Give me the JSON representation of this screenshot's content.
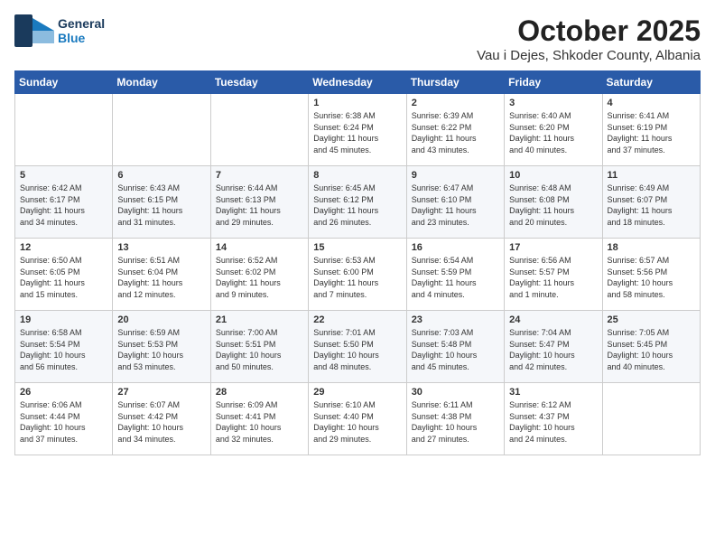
{
  "header": {
    "logo": {
      "general": "General",
      "blue": "Blue",
      "icon_shape": "arrow"
    },
    "title": "October 2025",
    "subtitle": "Vau i Dejes, Shkoder County, Albania"
  },
  "calendar": {
    "days_of_week": [
      "Sunday",
      "Monday",
      "Tuesday",
      "Wednesday",
      "Thursday",
      "Friday",
      "Saturday"
    ],
    "weeks": [
      [
        {
          "day": "",
          "info": ""
        },
        {
          "day": "",
          "info": ""
        },
        {
          "day": "",
          "info": ""
        },
        {
          "day": "1",
          "info": "Sunrise: 6:38 AM\nSunset: 6:24 PM\nDaylight: 11 hours\nand 45 minutes."
        },
        {
          "day": "2",
          "info": "Sunrise: 6:39 AM\nSunset: 6:22 PM\nDaylight: 11 hours\nand 43 minutes."
        },
        {
          "day": "3",
          "info": "Sunrise: 6:40 AM\nSunset: 6:20 PM\nDaylight: 11 hours\nand 40 minutes."
        },
        {
          "day": "4",
          "info": "Sunrise: 6:41 AM\nSunset: 6:19 PM\nDaylight: 11 hours\nand 37 minutes."
        }
      ],
      [
        {
          "day": "5",
          "info": "Sunrise: 6:42 AM\nSunset: 6:17 PM\nDaylight: 11 hours\nand 34 minutes."
        },
        {
          "day": "6",
          "info": "Sunrise: 6:43 AM\nSunset: 6:15 PM\nDaylight: 11 hours\nand 31 minutes."
        },
        {
          "day": "7",
          "info": "Sunrise: 6:44 AM\nSunset: 6:13 PM\nDaylight: 11 hours\nand 29 minutes."
        },
        {
          "day": "8",
          "info": "Sunrise: 6:45 AM\nSunset: 6:12 PM\nDaylight: 11 hours\nand 26 minutes."
        },
        {
          "day": "9",
          "info": "Sunrise: 6:47 AM\nSunset: 6:10 PM\nDaylight: 11 hours\nand 23 minutes."
        },
        {
          "day": "10",
          "info": "Sunrise: 6:48 AM\nSunset: 6:08 PM\nDaylight: 11 hours\nand 20 minutes."
        },
        {
          "day": "11",
          "info": "Sunrise: 6:49 AM\nSunset: 6:07 PM\nDaylight: 11 hours\nand 18 minutes."
        }
      ],
      [
        {
          "day": "12",
          "info": "Sunrise: 6:50 AM\nSunset: 6:05 PM\nDaylight: 11 hours\nand 15 minutes."
        },
        {
          "day": "13",
          "info": "Sunrise: 6:51 AM\nSunset: 6:04 PM\nDaylight: 11 hours\nand 12 minutes."
        },
        {
          "day": "14",
          "info": "Sunrise: 6:52 AM\nSunset: 6:02 PM\nDaylight: 11 hours\nand 9 minutes."
        },
        {
          "day": "15",
          "info": "Sunrise: 6:53 AM\nSunset: 6:00 PM\nDaylight: 11 hours\nand 7 minutes."
        },
        {
          "day": "16",
          "info": "Sunrise: 6:54 AM\nSunset: 5:59 PM\nDaylight: 11 hours\nand 4 minutes."
        },
        {
          "day": "17",
          "info": "Sunrise: 6:56 AM\nSunset: 5:57 PM\nDaylight: 11 hours\nand 1 minute."
        },
        {
          "day": "18",
          "info": "Sunrise: 6:57 AM\nSunset: 5:56 PM\nDaylight: 10 hours\nand 58 minutes."
        }
      ],
      [
        {
          "day": "19",
          "info": "Sunrise: 6:58 AM\nSunset: 5:54 PM\nDaylight: 10 hours\nand 56 minutes."
        },
        {
          "day": "20",
          "info": "Sunrise: 6:59 AM\nSunset: 5:53 PM\nDaylight: 10 hours\nand 53 minutes."
        },
        {
          "day": "21",
          "info": "Sunrise: 7:00 AM\nSunset: 5:51 PM\nDaylight: 10 hours\nand 50 minutes."
        },
        {
          "day": "22",
          "info": "Sunrise: 7:01 AM\nSunset: 5:50 PM\nDaylight: 10 hours\nand 48 minutes."
        },
        {
          "day": "23",
          "info": "Sunrise: 7:03 AM\nSunset: 5:48 PM\nDaylight: 10 hours\nand 45 minutes."
        },
        {
          "day": "24",
          "info": "Sunrise: 7:04 AM\nSunset: 5:47 PM\nDaylight: 10 hours\nand 42 minutes."
        },
        {
          "day": "25",
          "info": "Sunrise: 7:05 AM\nSunset: 5:45 PM\nDaylight: 10 hours\nand 40 minutes."
        }
      ],
      [
        {
          "day": "26",
          "info": "Sunrise: 6:06 AM\nSunset: 4:44 PM\nDaylight: 10 hours\nand 37 minutes."
        },
        {
          "day": "27",
          "info": "Sunrise: 6:07 AM\nSunset: 4:42 PM\nDaylight: 10 hours\nand 34 minutes."
        },
        {
          "day": "28",
          "info": "Sunrise: 6:09 AM\nSunset: 4:41 PM\nDaylight: 10 hours\nand 32 minutes."
        },
        {
          "day": "29",
          "info": "Sunrise: 6:10 AM\nSunset: 4:40 PM\nDaylight: 10 hours\nand 29 minutes."
        },
        {
          "day": "30",
          "info": "Sunrise: 6:11 AM\nSunset: 4:38 PM\nDaylight: 10 hours\nand 27 minutes."
        },
        {
          "day": "31",
          "info": "Sunrise: 6:12 AM\nSunset: 4:37 PM\nDaylight: 10 hours\nand 24 minutes."
        },
        {
          "day": "",
          "info": ""
        }
      ]
    ]
  }
}
